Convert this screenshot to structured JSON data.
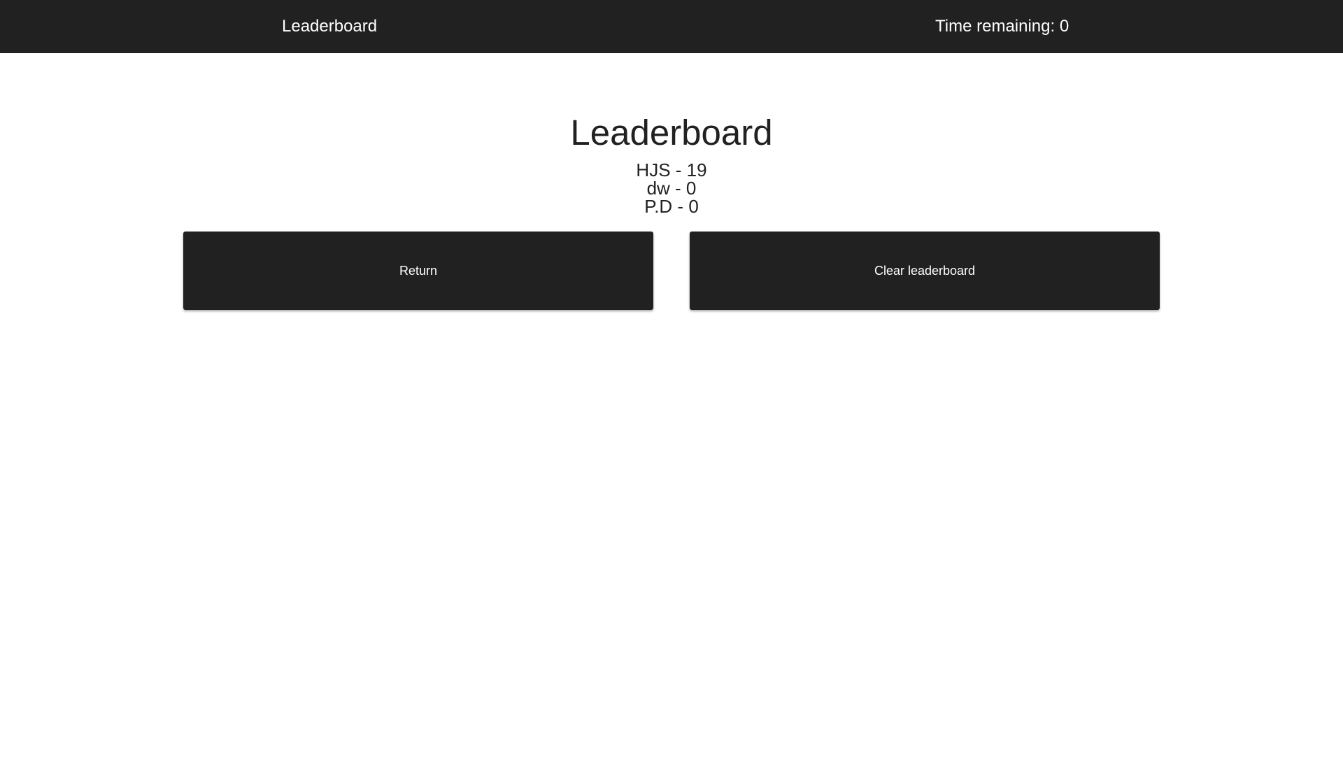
{
  "topbar": {
    "title": "Leaderboard",
    "timer": "Time remaining: 0"
  },
  "main": {
    "heading": "Leaderboard",
    "scores": [
      "HJS - 19",
      "dw - 0",
      "P.D - 0"
    ]
  },
  "actions": {
    "return_label": "Return",
    "clear_label": "Clear leaderboard"
  },
  "colors": {
    "bar": "#212121",
    "background": "#ffffff",
    "text": "#212121"
  }
}
